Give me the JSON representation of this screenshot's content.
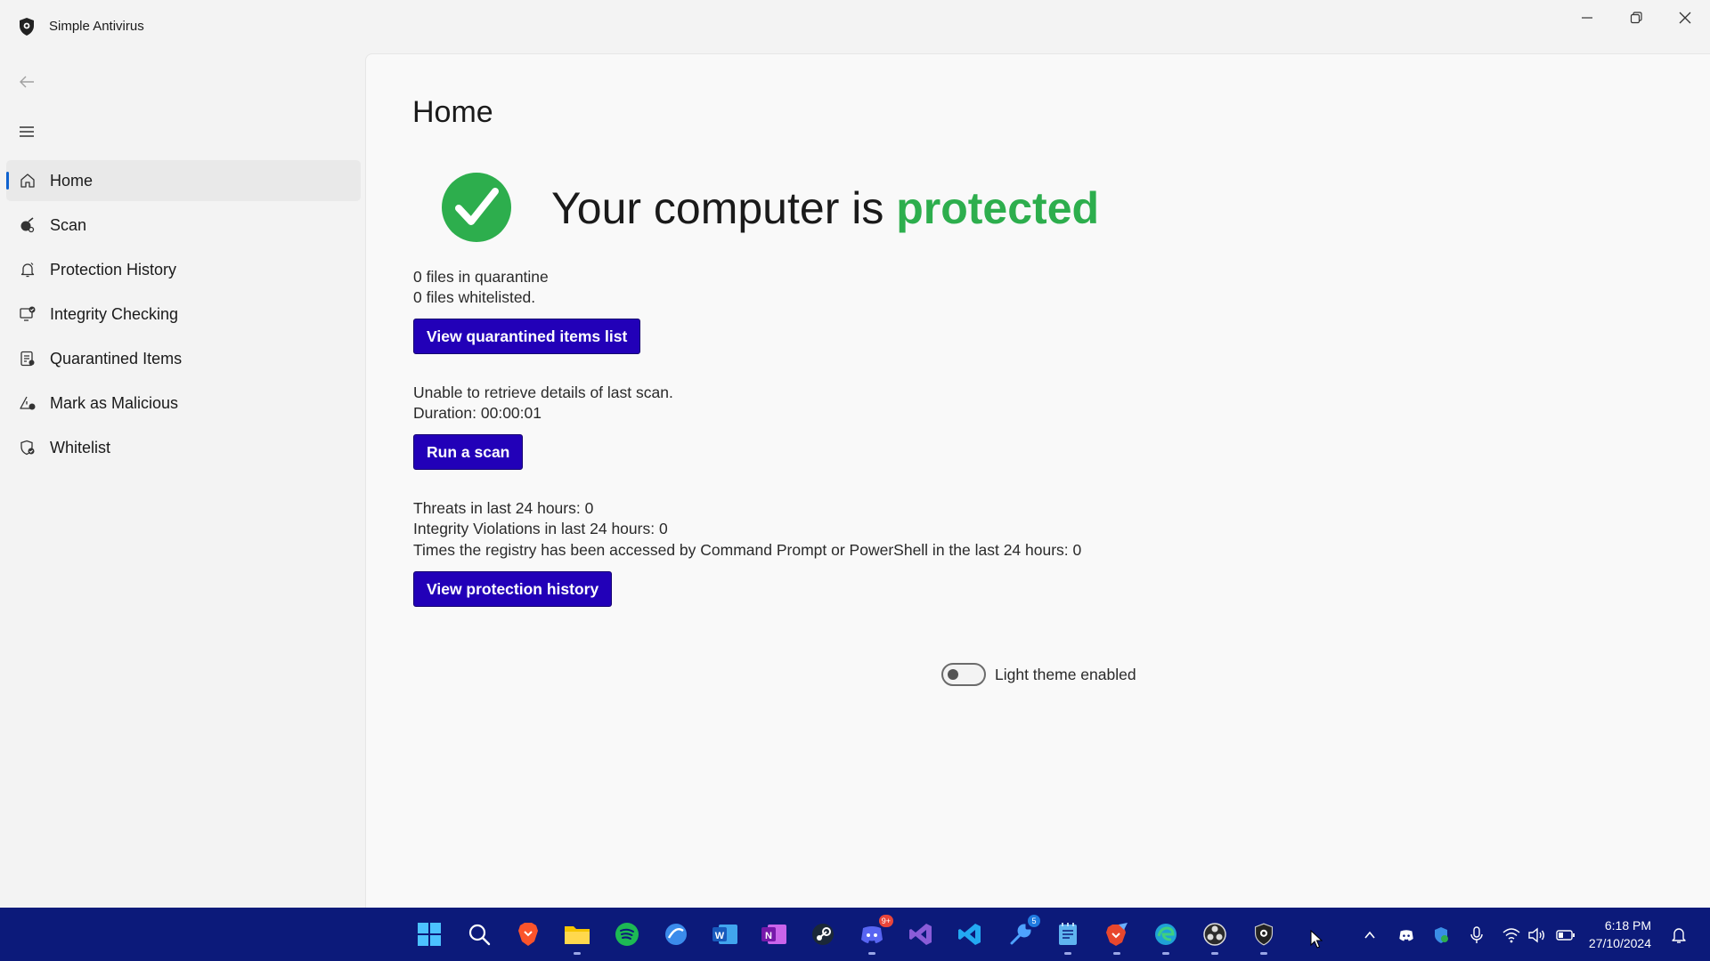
{
  "window": {
    "title": "Simple Antivirus"
  },
  "sidebar": {
    "items": [
      {
        "label": "Home",
        "icon": "home-icon",
        "active": true
      },
      {
        "label": "Scan",
        "icon": "scan-icon",
        "active": false
      },
      {
        "label": "Protection History",
        "icon": "bell-icon",
        "active": false
      },
      {
        "label": "Integrity Checking",
        "icon": "monitor-check-icon",
        "active": false
      },
      {
        "label": "Quarantined Items",
        "icon": "document-list-icon",
        "active": false
      },
      {
        "label": "Mark as Malicious",
        "icon": "warning-icon",
        "active": false
      },
      {
        "label": "Whitelist",
        "icon": "shield-check-icon",
        "active": false
      }
    ]
  },
  "main": {
    "title": "Home",
    "status_prefix": "Your computer is ",
    "status_word": "protected",
    "quarantine_count": "0 files in quarantine",
    "whitelist_count": "0 files whitelisted.",
    "view_quarantine_label": "View quarantined items list",
    "last_scan": "Unable to retrieve details of last scan.",
    "duration": "Duration: 00:00:01",
    "run_scan_label": "Run a scan",
    "threats": "Threats in last 24 hours: 0",
    "integrity": "Integrity Violations in last 24 hours: 0",
    "registry": "Times the registry has been accessed by Command Prompt or PowerShell in the last 24 hours: 0",
    "view_history_label": "View protection history",
    "theme_toggle_label": "Light theme enabled",
    "theme_toggle_on": false
  },
  "taskbar": {
    "apps": [
      "windows-start-icon",
      "search-icon",
      "brave-icon",
      "file-explorer-icon",
      "spotify-icon",
      "browser-icon",
      "word-icon",
      "onenote-icon",
      "steam-icon",
      "discord-icon",
      "visual-studio-icon",
      "vscode-icon",
      "tools-icon",
      "notepad-icon",
      "brave-nightly-icon",
      "edge-icon",
      "obs-icon",
      "simple-antivirus-icon"
    ],
    "discord_badge": "9+",
    "tools_badge": "5",
    "time": "6:18 PM",
    "date": "27/10/2024"
  },
  "colors": {
    "accent_button": "#2200b8",
    "protected_green": "#2dae4d",
    "taskbar": "#0c1a7a",
    "nav_indicator": "#0f62cf"
  }
}
